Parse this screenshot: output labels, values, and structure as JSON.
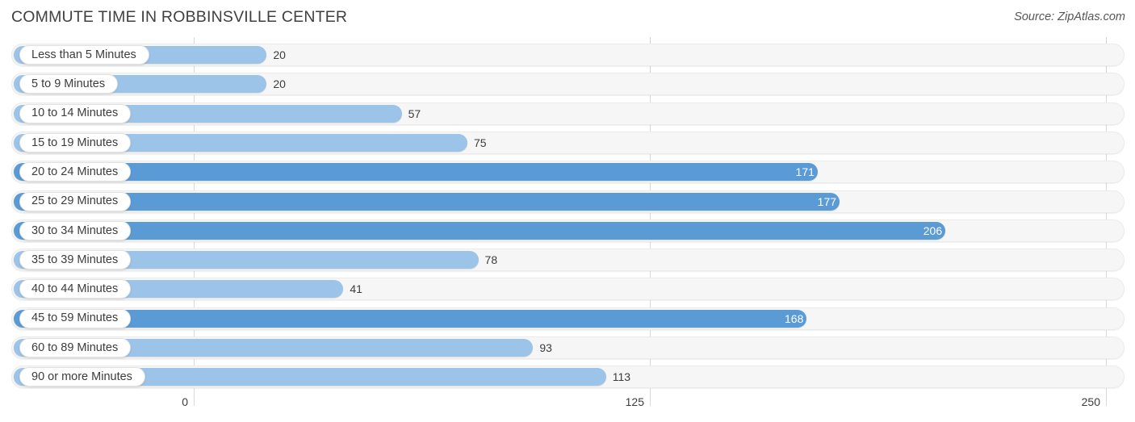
{
  "header": {
    "title": "COMMUTE TIME IN ROBBINSVILLE CENTER",
    "source": "Source: ZipAtlas.com"
  },
  "colors": {
    "bar_light": "#9cc3e8",
    "bar_dark": "#5b9bd5",
    "track": "#f6f6f6",
    "gridline": "#d9d9d9",
    "text": "#3c3c3c"
  },
  "chart_data": {
    "type": "bar",
    "orientation": "horizontal",
    "title": "COMMUTE TIME IN ROBBINSVILLE CENTER",
    "xlabel": "",
    "ylabel": "",
    "xlim": [
      0,
      250
    ],
    "ticks": [
      "0",
      "125",
      "250"
    ],
    "tick_values": [
      0,
      125,
      250
    ],
    "grid": true,
    "legend": "none",
    "categories": [
      "Less than 5 Minutes",
      "5 to 9 Minutes",
      "10 to 14 Minutes",
      "15 to 19 Minutes",
      "20 to 24 Minutes",
      "25 to 29 Minutes",
      "30 to 34 Minutes",
      "35 to 39 Minutes",
      "40 to 44 Minutes",
      "45 to 59 Minutes",
      "60 to 89 Minutes",
      "90 or more Minutes"
    ],
    "values": [
      20,
      20,
      57,
      75,
      171,
      177,
      206,
      78,
      41,
      168,
      93,
      113
    ],
    "value_labels": [
      "20",
      "20",
      "57",
      "75",
      "171",
      "177",
      "206",
      "78",
      "41",
      "168",
      "93",
      "113"
    ]
  },
  "rows": [
    {
      "label": "Less than 5 Minutes",
      "value": 20,
      "value_label": "20",
      "inside": false,
      "shade": "light"
    },
    {
      "label": "5 to 9 Minutes",
      "value": 20,
      "value_label": "20",
      "inside": false,
      "shade": "light"
    },
    {
      "label": "10 to 14 Minutes",
      "value": 57,
      "value_label": "57",
      "inside": false,
      "shade": "light"
    },
    {
      "label": "15 to 19 Minutes",
      "value": 75,
      "value_label": "75",
      "inside": false,
      "shade": "light"
    },
    {
      "label": "20 to 24 Minutes",
      "value": 171,
      "value_label": "171",
      "inside": true,
      "shade": "dark"
    },
    {
      "label": "25 to 29 Minutes",
      "value": 177,
      "value_label": "177",
      "inside": true,
      "shade": "dark"
    },
    {
      "label": "30 to 34 Minutes",
      "value": 206,
      "value_label": "206",
      "inside": true,
      "shade": "dark"
    },
    {
      "label": "35 to 39 Minutes",
      "value": 78,
      "value_label": "78",
      "inside": false,
      "shade": "light"
    },
    {
      "label": "40 to 44 Minutes",
      "value": 41,
      "value_label": "41",
      "inside": false,
      "shade": "light"
    },
    {
      "label": "45 to 59 Minutes",
      "value": 168,
      "value_label": "168",
      "inside": true,
      "shade": "dark"
    },
    {
      "label": "60 to 89 Minutes",
      "value": 93,
      "value_label": "93",
      "inside": false,
      "shade": "light"
    },
    {
      "label": "90 or more Minutes",
      "value": 113,
      "value_label": "113",
      "inside": false,
      "shade": "light"
    }
  ],
  "axis": {
    "ticks": [
      {
        "label": "0",
        "value": 0
      },
      {
        "label": "125",
        "value": 125
      },
      {
        "label": "250",
        "value": 250
      }
    ]
  }
}
